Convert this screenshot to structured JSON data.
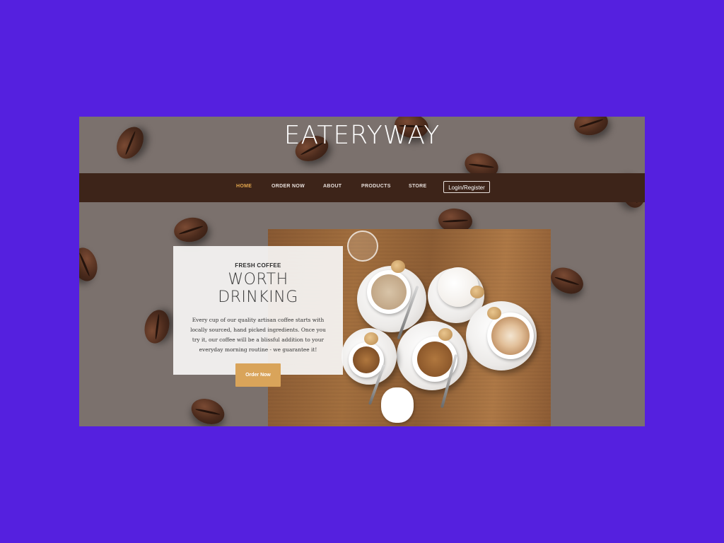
{
  "brand": {
    "name": "EATERYWAY"
  },
  "nav": {
    "items": [
      {
        "label": "HOME"
      },
      {
        "label": "ORDER NOW"
      },
      {
        "label": "ABOUT"
      },
      {
        "label": "PRODUCTS"
      },
      {
        "label": "STORE"
      }
    ],
    "login_label": "Login/Register"
  },
  "hero": {
    "eyebrow": "FRESH COFFEE",
    "headline_line1": "WORTH",
    "headline_line2": "DRINKING",
    "body": "Every cup of our quality artisan coffee starts with locally sourced, hand picked ingredients. Once you try it, our coffee will be a blissful addition to your everyday morning routine - we guarantee it!",
    "cta_label": "Order Now"
  },
  "colors": {
    "page_background": "#5520df",
    "frame_background": "#7b716d",
    "navbar": "#3d2419",
    "accent": "#e3a64d",
    "cta": "#d9a45a"
  }
}
